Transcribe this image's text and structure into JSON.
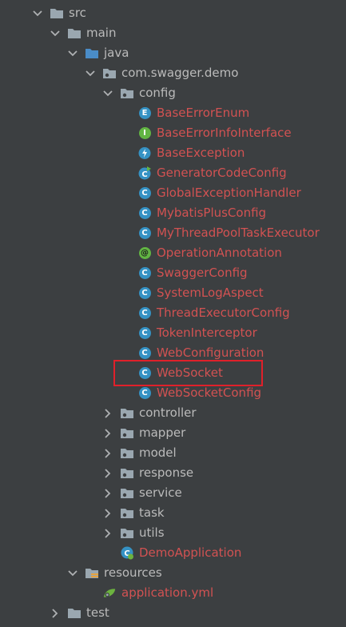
{
  "tree": [
    {
      "label": "src",
      "depth": 0,
      "expanded": true,
      "icon": "folder-icon",
      "color": "plain"
    },
    {
      "label": "main",
      "depth": 1,
      "expanded": true,
      "icon": "folder-icon",
      "color": "plain"
    },
    {
      "label": "java",
      "depth": 2,
      "expanded": true,
      "icon": "source-folder-icon",
      "color": "plain"
    },
    {
      "label": "com.swagger.demo",
      "depth": 3,
      "expanded": true,
      "icon": "package-icon",
      "color": "plain"
    },
    {
      "label": "config",
      "depth": 4,
      "expanded": true,
      "icon": "package-icon",
      "color": "plain"
    },
    {
      "label": "BaseErrorEnum",
      "depth": 5,
      "icon": "enum-icon",
      "color": "red"
    },
    {
      "label": "BaseErrorInfoInterface",
      "depth": 5,
      "icon": "interface-icon",
      "color": "red"
    },
    {
      "label": "BaseException",
      "depth": 5,
      "icon": "exception-class-icon",
      "color": "red"
    },
    {
      "label": "GeneratorCodeConfig",
      "depth": 5,
      "icon": "runnable-class-icon",
      "color": "red"
    },
    {
      "label": "GlobalExceptionHandler",
      "depth": 5,
      "icon": "class-icon",
      "color": "red"
    },
    {
      "label": "MybatisPlusConfig",
      "depth": 5,
      "icon": "class-icon",
      "color": "red"
    },
    {
      "label": "MyThreadPoolTaskExecutor",
      "depth": 5,
      "icon": "class-icon",
      "color": "red"
    },
    {
      "label": "OperationAnnotation",
      "depth": 5,
      "icon": "annotation-icon",
      "color": "red"
    },
    {
      "label": "SwaggerConfig",
      "depth": 5,
      "icon": "class-icon",
      "color": "red"
    },
    {
      "label": "SystemLogAspect",
      "depth": 5,
      "icon": "class-icon",
      "color": "red"
    },
    {
      "label": "ThreadExecutorConfig",
      "depth": 5,
      "icon": "class-icon",
      "color": "red"
    },
    {
      "label": "TokenInterceptor",
      "depth": 5,
      "icon": "class-icon",
      "color": "red"
    },
    {
      "label": "WebConfiguration",
      "depth": 5,
      "icon": "class-icon",
      "color": "red"
    },
    {
      "label": "WebSocket",
      "depth": 5,
      "icon": "class-icon",
      "color": "red"
    },
    {
      "label": "WebSocketConfig",
      "depth": 5,
      "icon": "class-icon",
      "color": "red"
    },
    {
      "label": "controller",
      "depth": 4,
      "expanded": false,
      "icon": "package-icon",
      "color": "plain"
    },
    {
      "label": "mapper",
      "depth": 4,
      "expanded": false,
      "icon": "package-icon",
      "color": "plain"
    },
    {
      "label": "model",
      "depth": 4,
      "expanded": false,
      "icon": "package-icon",
      "color": "plain"
    },
    {
      "label": "response",
      "depth": 4,
      "expanded": false,
      "icon": "package-icon",
      "color": "plain"
    },
    {
      "label": "service",
      "depth": 4,
      "expanded": false,
      "icon": "package-icon",
      "color": "plain"
    },
    {
      "label": "task",
      "depth": 4,
      "expanded": false,
      "icon": "package-icon",
      "color": "plain"
    },
    {
      "label": "utils",
      "depth": 4,
      "expanded": false,
      "icon": "package-icon",
      "color": "plain"
    },
    {
      "label": "DemoApplication",
      "depth": 4,
      "icon": "spring-boot-class-icon",
      "color": "red"
    },
    {
      "label": "resources",
      "depth": 2,
      "expanded": true,
      "icon": "resources-folder-icon",
      "color": "plain"
    },
    {
      "label": "application.yml",
      "depth": 3,
      "icon": "spring-yml-icon",
      "color": "red"
    },
    {
      "label": "test",
      "depth": 1,
      "expanded": false,
      "icon": "folder-icon",
      "color": "plain"
    }
  ],
  "colors": {
    "background": "#3c3f41",
    "text": "#bbbbbb",
    "modified_file": "#d25252",
    "class_badge": "#3592c4",
    "interface_badge": "#62b543",
    "highlight_box": "#e0202a"
  },
  "highlighted_item": "WebSocket"
}
